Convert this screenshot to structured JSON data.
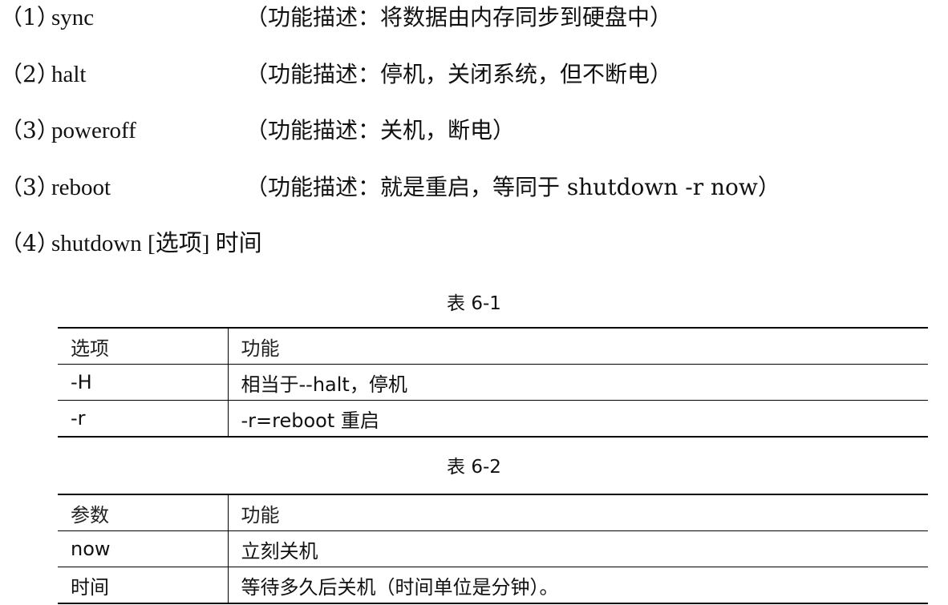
{
  "lines": [
    {
      "num": "（1）",
      "cmd": "sync",
      "desc": "（功能描述：将数据由内存同步到硬盘中）"
    },
    {
      "num": "（2）",
      "cmd": "halt",
      "desc": "（功能描述：停机，关闭系统，但不断电）"
    },
    {
      "num": "（3）",
      "cmd": "poweroff",
      "desc": "（功能描述：关机，断电）"
    },
    {
      "num": "（3）",
      "cmd": "reboot",
      "desc": "（功能描述：就是重启，等同于 shutdown -r now）"
    },
    {
      "num": "（4）",
      "cmd": "shutdown [选项] 时间",
      "desc": ""
    }
  ],
  "table1": {
    "caption": "表 6-1",
    "header": [
      "选项",
      "功能"
    ],
    "rows": [
      [
        "-H",
        "相当于--halt，停机"
      ],
      [
        "-r",
        "-r=reboot 重启"
      ]
    ]
  },
  "table2": {
    "caption": "表 6-2",
    "header": [
      "参数",
      "功能"
    ],
    "rows": [
      [
        "now",
        "立刻关机"
      ],
      [
        "时间",
        "等待多久后关机（时间单位是分钟）。"
      ]
    ]
  }
}
